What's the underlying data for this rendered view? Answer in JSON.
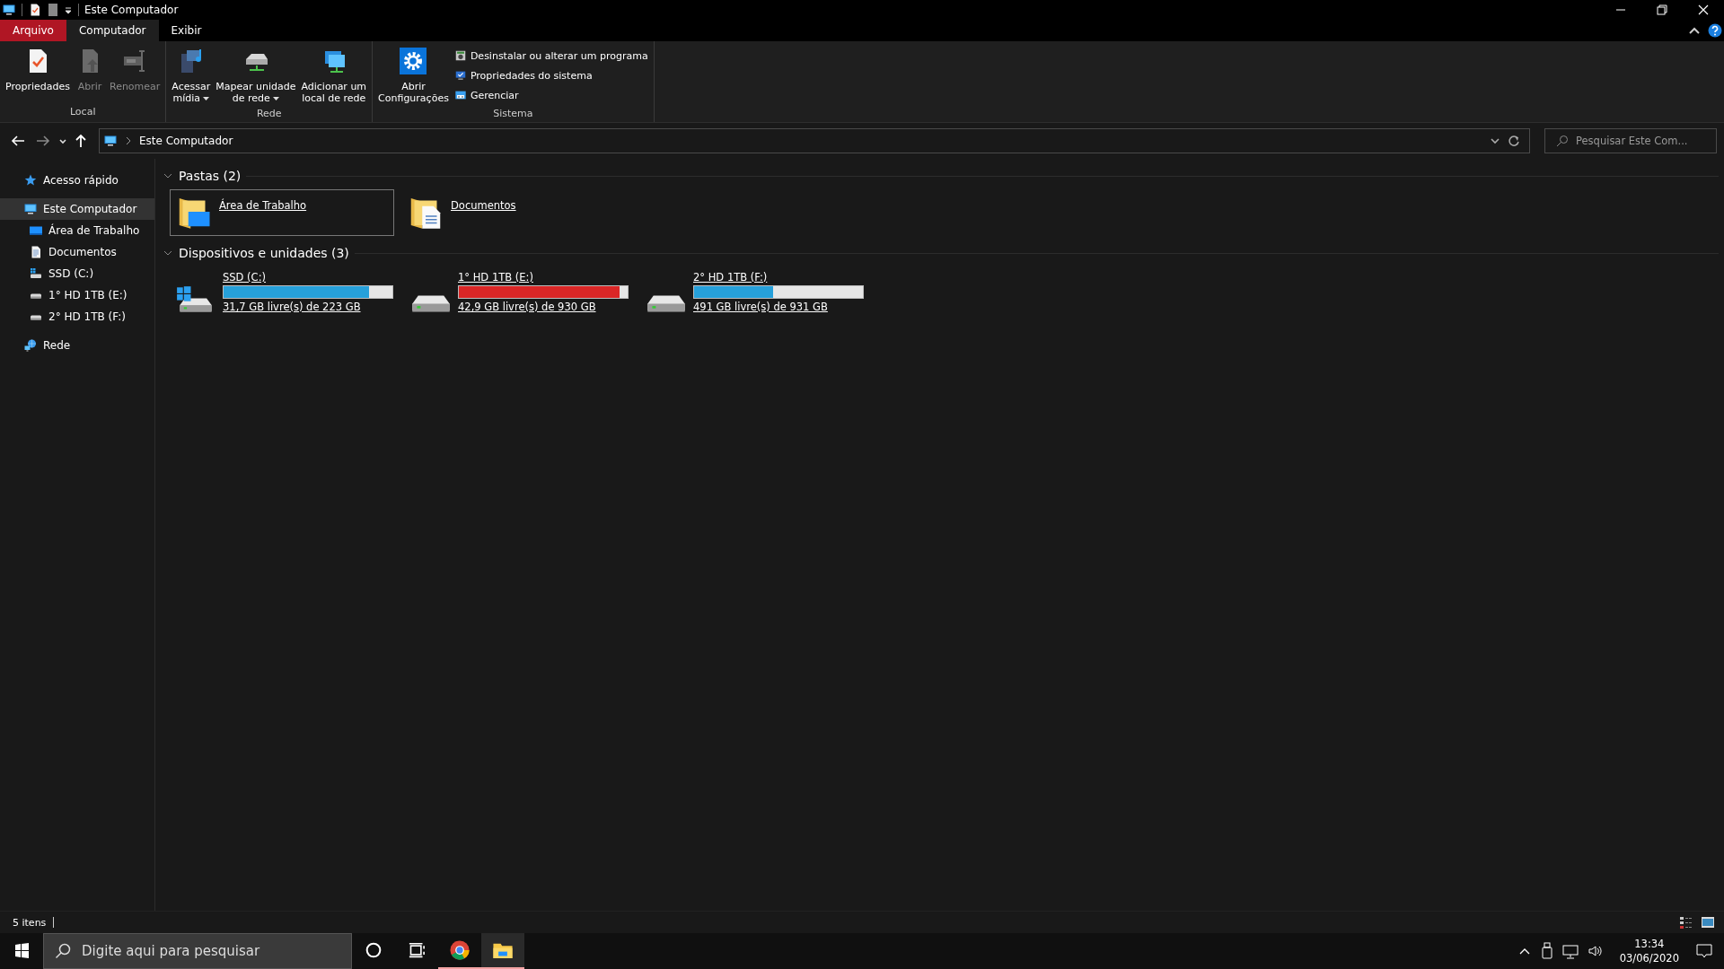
{
  "window": {
    "title": "Este Computador"
  },
  "ribbon_tabs": [
    {
      "label": "Arquivo",
      "kind": "file",
      "selected": false
    },
    {
      "label": "Computador",
      "kind": "tab",
      "selected": true
    },
    {
      "label": "Exibir",
      "kind": "tab",
      "selected": false
    }
  ],
  "ribbon_groups": [
    {
      "label": "Local",
      "buttons": [
        {
          "lines": [
            "Propriedades"
          ],
          "disabled": false,
          "dropdown": false
        },
        {
          "lines": [
            "Abrir"
          ],
          "disabled": true,
          "dropdown": false
        },
        {
          "lines": [
            "Renomear"
          ],
          "disabled": true,
          "dropdown": false
        }
      ]
    },
    {
      "label": "Rede",
      "buttons": [
        {
          "lines": [
            "Acessar",
            "mídia"
          ],
          "disabled": false,
          "dropdown": true
        },
        {
          "lines": [
            "Mapear unidade",
            "de rede"
          ],
          "disabled": false,
          "dropdown": true
        },
        {
          "lines": [
            "Adicionar um",
            "local de rede"
          ],
          "disabled": false,
          "dropdown": false
        }
      ]
    },
    {
      "label": "Sistema",
      "buttons": [
        {
          "lines": [
            "Abrir",
            "Configurações"
          ],
          "disabled": false,
          "dropdown": false
        }
      ],
      "small_buttons": [
        {
          "label": "Desinstalar ou alterar um programa"
        },
        {
          "label": "Propriedades do sistema"
        },
        {
          "label": "Gerenciar"
        }
      ]
    }
  ],
  "address": {
    "path": "Este Computador"
  },
  "search": {
    "placeholder": "Pesquisar Este Com..."
  },
  "navigation": [
    {
      "label": "Acesso rápido",
      "selected": false
    },
    {
      "label": "Este Computador",
      "selected": true,
      "children": [
        {
          "label": "Área de Trabalho",
          "selected": false
        },
        {
          "label": "Documentos",
          "selected": false
        },
        {
          "label": "SSD (C:)",
          "selected": false
        },
        {
          "label": "1° HD 1TB (E:)",
          "selected": false
        },
        {
          "label": "2° HD 1TB  (F:)",
          "selected": false
        }
      ]
    },
    {
      "label": "Rede",
      "selected": false
    }
  ],
  "sections": [
    {
      "title": "Pastas (2)",
      "kind": "folders",
      "items": [
        {
          "name": "Área de Trabalho",
          "selected": true
        },
        {
          "name": "Documentos",
          "selected": false
        }
      ]
    },
    {
      "title": "Dispositivos e unidades (3)",
      "kind": "drives",
      "items": [
        {
          "name": "SSD (C:)",
          "level": 0.86,
          "color": "#26a0da",
          "free": "31,7 GB livre(s) de 223 GB"
        },
        {
          "name": "1° HD 1TB (E:)",
          "level": 0.95,
          "color": "#da2626",
          "free": "42,9 GB livre(s) de 930 GB"
        },
        {
          "name": "2° HD 1TB  (F:)",
          "level": 0.47,
          "color": "#26a0da",
          "free": "491 GB livre(s) de 931 GB"
        }
      ]
    }
  ],
  "status_bar": {
    "item_count": "5 itens"
  },
  "taskbar": {
    "search_placeholder": "Digite aqui para pesquisar",
    "apps": [
      {
        "active": false
      },
      {
        "active": false
      },
      {
        "active": true
      },
      {
        "active": true
      }
    ],
    "time": "13:34",
    "date": "03/06/2020"
  }
}
